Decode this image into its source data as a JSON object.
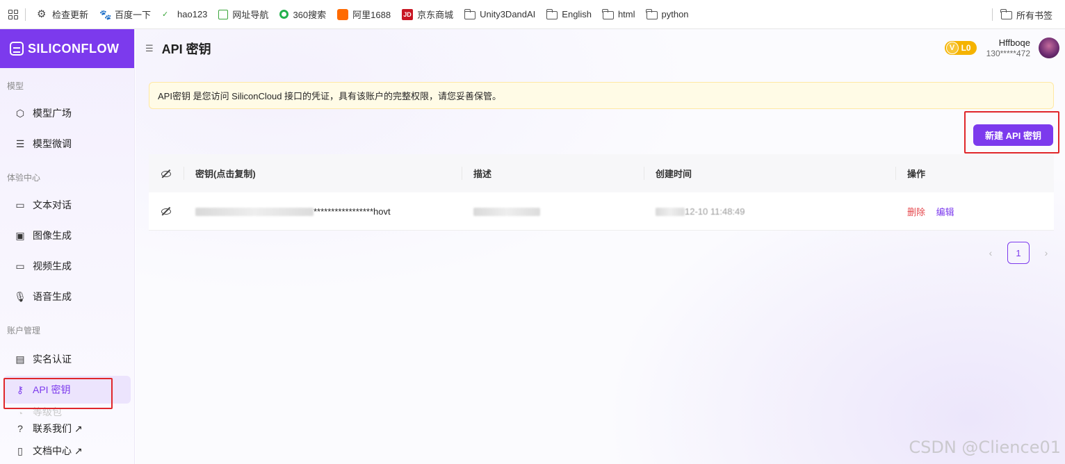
{
  "bookmarks": {
    "items": [
      {
        "label": "检查更新",
        "icon": "gear-icon"
      },
      {
        "label": "百度一下",
        "icon": "baidu-paw-icon"
      },
      {
        "label": "hao123",
        "icon": "hao123-icon"
      },
      {
        "label": "网址导航",
        "icon": "2345-icon"
      },
      {
        "label": "360搜索",
        "icon": "360-search-icon"
      },
      {
        "label": "阿里1688",
        "icon": "1688-icon"
      },
      {
        "label": "京东商城",
        "icon": "jd-icon"
      },
      {
        "label": "Unity3DandAI",
        "icon": "folder-icon"
      },
      {
        "label": "English",
        "icon": "folder-icon"
      },
      {
        "label": "html",
        "icon": "folder-icon"
      },
      {
        "label": "python",
        "icon": "folder-icon"
      }
    ],
    "all_bookmarks": "所有书签"
  },
  "app": {
    "brand": "SILICONFLOW",
    "accent": "#7c3aed"
  },
  "sidebar": {
    "sections": [
      {
        "title": "模型",
        "items": [
          {
            "label": "模型广场",
            "icon": "cube-icon"
          },
          {
            "label": "模型微调",
            "icon": "sliders-icon"
          }
        ]
      },
      {
        "title": "体验中心",
        "items": [
          {
            "label": "文本对话",
            "icon": "chat-bubble-icon"
          },
          {
            "label": "图像生成",
            "icon": "image-icon"
          },
          {
            "label": "视频生成",
            "icon": "video-camera-icon"
          },
          {
            "label": "语音生成",
            "icon": "microphone-icon"
          }
        ]
      },
      {
        "title": "账户管理",
        "items": [
          {
            "label": "实名认证",
            "icon": "id-card-icon"
          },
          {
            "label": "API 密钥",
            "icon": "key-icon",
            "active": true
          },
          {
            "label": "等级包",
            "icon": "package-icon"
          }
        ]
      }
    ],
    "footer": [
      {
        "label": "联系我们 ↗",
        "icon": "question-circle-icon"
      },
      {
        "label": "文档中心 ↗",
        "icon": "document-icon"
      }
    ]
  },
  "header": {
    "title": "API 密钥",
    "level_badge": "L0",
    "username": "Hffboqe",
    "phone": "130*****472"
  },
  "notice": "API密钥 是您访问 SiliconCloud 接口的凭证，具有该账户的完整权限，请您妥善保管。",
  "new_key_button": "新建 API 密钥",
  "table": {
    "headers": [
      "密钥(点击复制)",
      "描述",
      "创建时间",
      "操作"
    ],
    "rows": [
      {
        "key_masked": "*****************hovt",
        "description": "",
        "created": "12-10 11:48:49",
        "actions": [
          "删除",
          "编辑"
        ]
      }
    ]
  },
  "pagination": {
    "prev": "‹",
    "current": "1",
    "next": "›"
  },
  "watermark": "CSDN @Clience01"
}
